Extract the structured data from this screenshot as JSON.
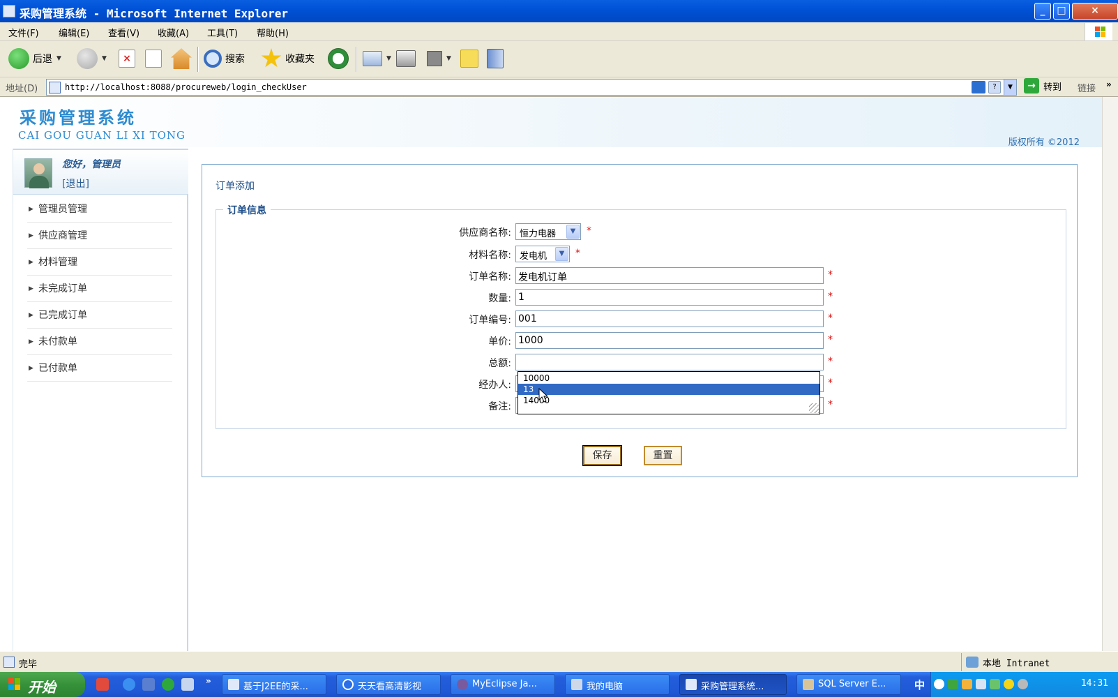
{
  "window": {
    "title": "采购管理系统 - Microsoft Internet Explorer",
    "min_label": "_",
    "max_label": "□",
    "close_label": "×"
  },
  "menubar": {
    "items": [
      "文件(F)",
      "编辑(E)",
      "查看(V)",
      "收藏(A)",
      "工具(T)",
      "帮助(H)"
    ]
  },
  "toolbar": {
    "back_label": "后退",
    "search_label": "搜索",
    "favorites_label": "收藏夹"
  },
  "addressbar": {
    "label": "地址(D)",
    "url": "http://localhost:8088/procureweb/login_checkUser",
    "go_label": "转到",
    "links_label": "链接"
  },
  "header": {
    "title": "采购管理系统",
    "pinyin": "CAI GOU GUAN LI XI TONG",
    "copyright": "版权所有   ©2012"
  },
  "sidebar": {
    "greeting": "您好，管理员",
    "logout": "[退出]",
    "items": [
      {
        "label": "管理员管理"
      },
      {
        "label": "供应商管理"
      },
      {
        "label": "材料管理"
      },
      {
        "label": "未完成订单"
      },
      {
        "label": "已完成订单"
      },
      {
        "label": "未付款单"
      },
      {
        "label": "已付款单"
      }
    ]
  },
  "main": {
    "breadcrumb": "订单添加",
    "legend": "订单信息",
    "required_mark": "*",
    "fields": {
      "supplier": {
        "label": "供应商名称:",
        "value": "恒力电器"
      },
      "material": {
        "label": "材料名称:",
        "value": "发电机"
      },
      "order_name": {
        "label": "订单名称:",
        "value": "发电机订单"
      },
      "quantity": {
        "label": "数量:",
        "value": "1"
      },
      "order_no": {
        "label": "订单编号:",
        "value": "001"
      },
      "unit_price": {
        "label": "单价:",
        "value": "1000"
      },
      "total": {
        "label": "总额:",
        "value": ""
      },
      "handler": {
        "label": "经办人:",
        "value": ""
      },
      "remark": {
        "label": "备注:",
        "value": ""
      }
    },
    "autocomplete": [
      "10000",
      "13",
      "14000"
    ],
    "autocomplete_selected": 1,
    "save_label": "保存",
    "reset_label": "重置"
  },
  "statusbar": {
    "status": "完毕",
    "zone": "本地 Intranet"
  },
  "taskbar": {
    "start_label": "开始",
    "tasks": [
      {
        "label": "基于J2EE的采..."
      },
      {
        "label": "天天看高清影视"
      },
      {
        "label": "MyEclipse Ja..."
      },
      {
        "label": "我的电脑"
      },
      {
        "label": "采购管理系统..."
      },
      {
        "label": "SQL Server E..."
      }
    ],
    "ime": "中",
    "clock": "14:31"
  }
}
